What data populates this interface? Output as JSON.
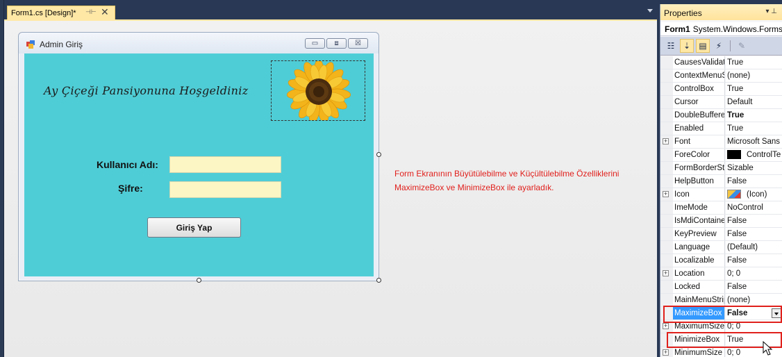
{
  "tab": {
    "label": "Form1.cs [Design]*",
    "pin": "⊣⊢",
    "close": "✕"
  },
  "form": {
    "title": "Admin Giriş",
    "welcome": "Ay Çiçeği Pansiyonuna Hoşgeldiniz",
    "username_label": "Kullanıcı Adı:",
    "password_label": "Şifre:",
    "username_value": "",
    "password_value": "",
    "login_button": "Giriş Yap",
    "caption_min": "▭",
    "caption_max": "⧈",
    "caption_close": "☒"
  },
  "annotation": "Form Ekranının Büyütülebilme ve Küçültülebilme Özelliklerini MaximizeBox ve MinimizeBox ile ayarladık.",
  "properties": {
    "header": "Properties",
    "header_ctrls": "▾ ⊥",
    "object_name": "Form1",
    "object_type": "System.Windows.Forms.",
    "rows": [
      {
        "name": "CausesValidation",
        "value": "True"
      },
      {
        "name": "ContextMenuStrip",
        "value": "(none)"
      },
      {
        "name": "ControlBox",
        "value": "True"
      },
      {
        "name": "Cursor",
        "value": "Default"
      },
      {
        "name": "DoubleBuffered",
        "value": "True"
      },
      {
        "name": "Enabled",
        "value": "True"
      },
      {
        "name": "Font",
        "value": "Microsoft Sans"
      },
      {
        "name": "ForeColor",
        "value": "ControlTe"
      },
      {
        "name": "FormBorderStyle",
        "value": "Sizable"
      },
      {
        "name": "HelpButton",
        "value": "False"
      },
      {
        "name": "Icon",
        "value": "(Icon)"
      },
      {
        "name": "ImeMode",
        "value": "NoControl"
      },
      {
        "name": "IsMdiContainer",
        "value": "False"
      },
      {
        "name": "KeyPreview",
        "value": "False"
      },
      {
        "name": "Language",
        "value": "(Default)"
      },
      {
        "name": "Localizable",
        "value": "False"
      },
      {
        "name": "Location",
        "value": "0; 0"
      },
      {
        "name": "Locked",
        "value": "False"
      },
      {
        "name": "MainMenuStrip",
        "value": "(none)"
      },
      {
        "name": "MaximizeBox",
        "value": "False"
      },
      {
        "name": "MaximumSize",
        "value": "0; 0"
      },
      {
        "name": "MinimizeBox",
        "value": "True"
      },
      {
        "name": "MinimumSize",
        "value": "0; 0"
      }
    ]
  }
}
